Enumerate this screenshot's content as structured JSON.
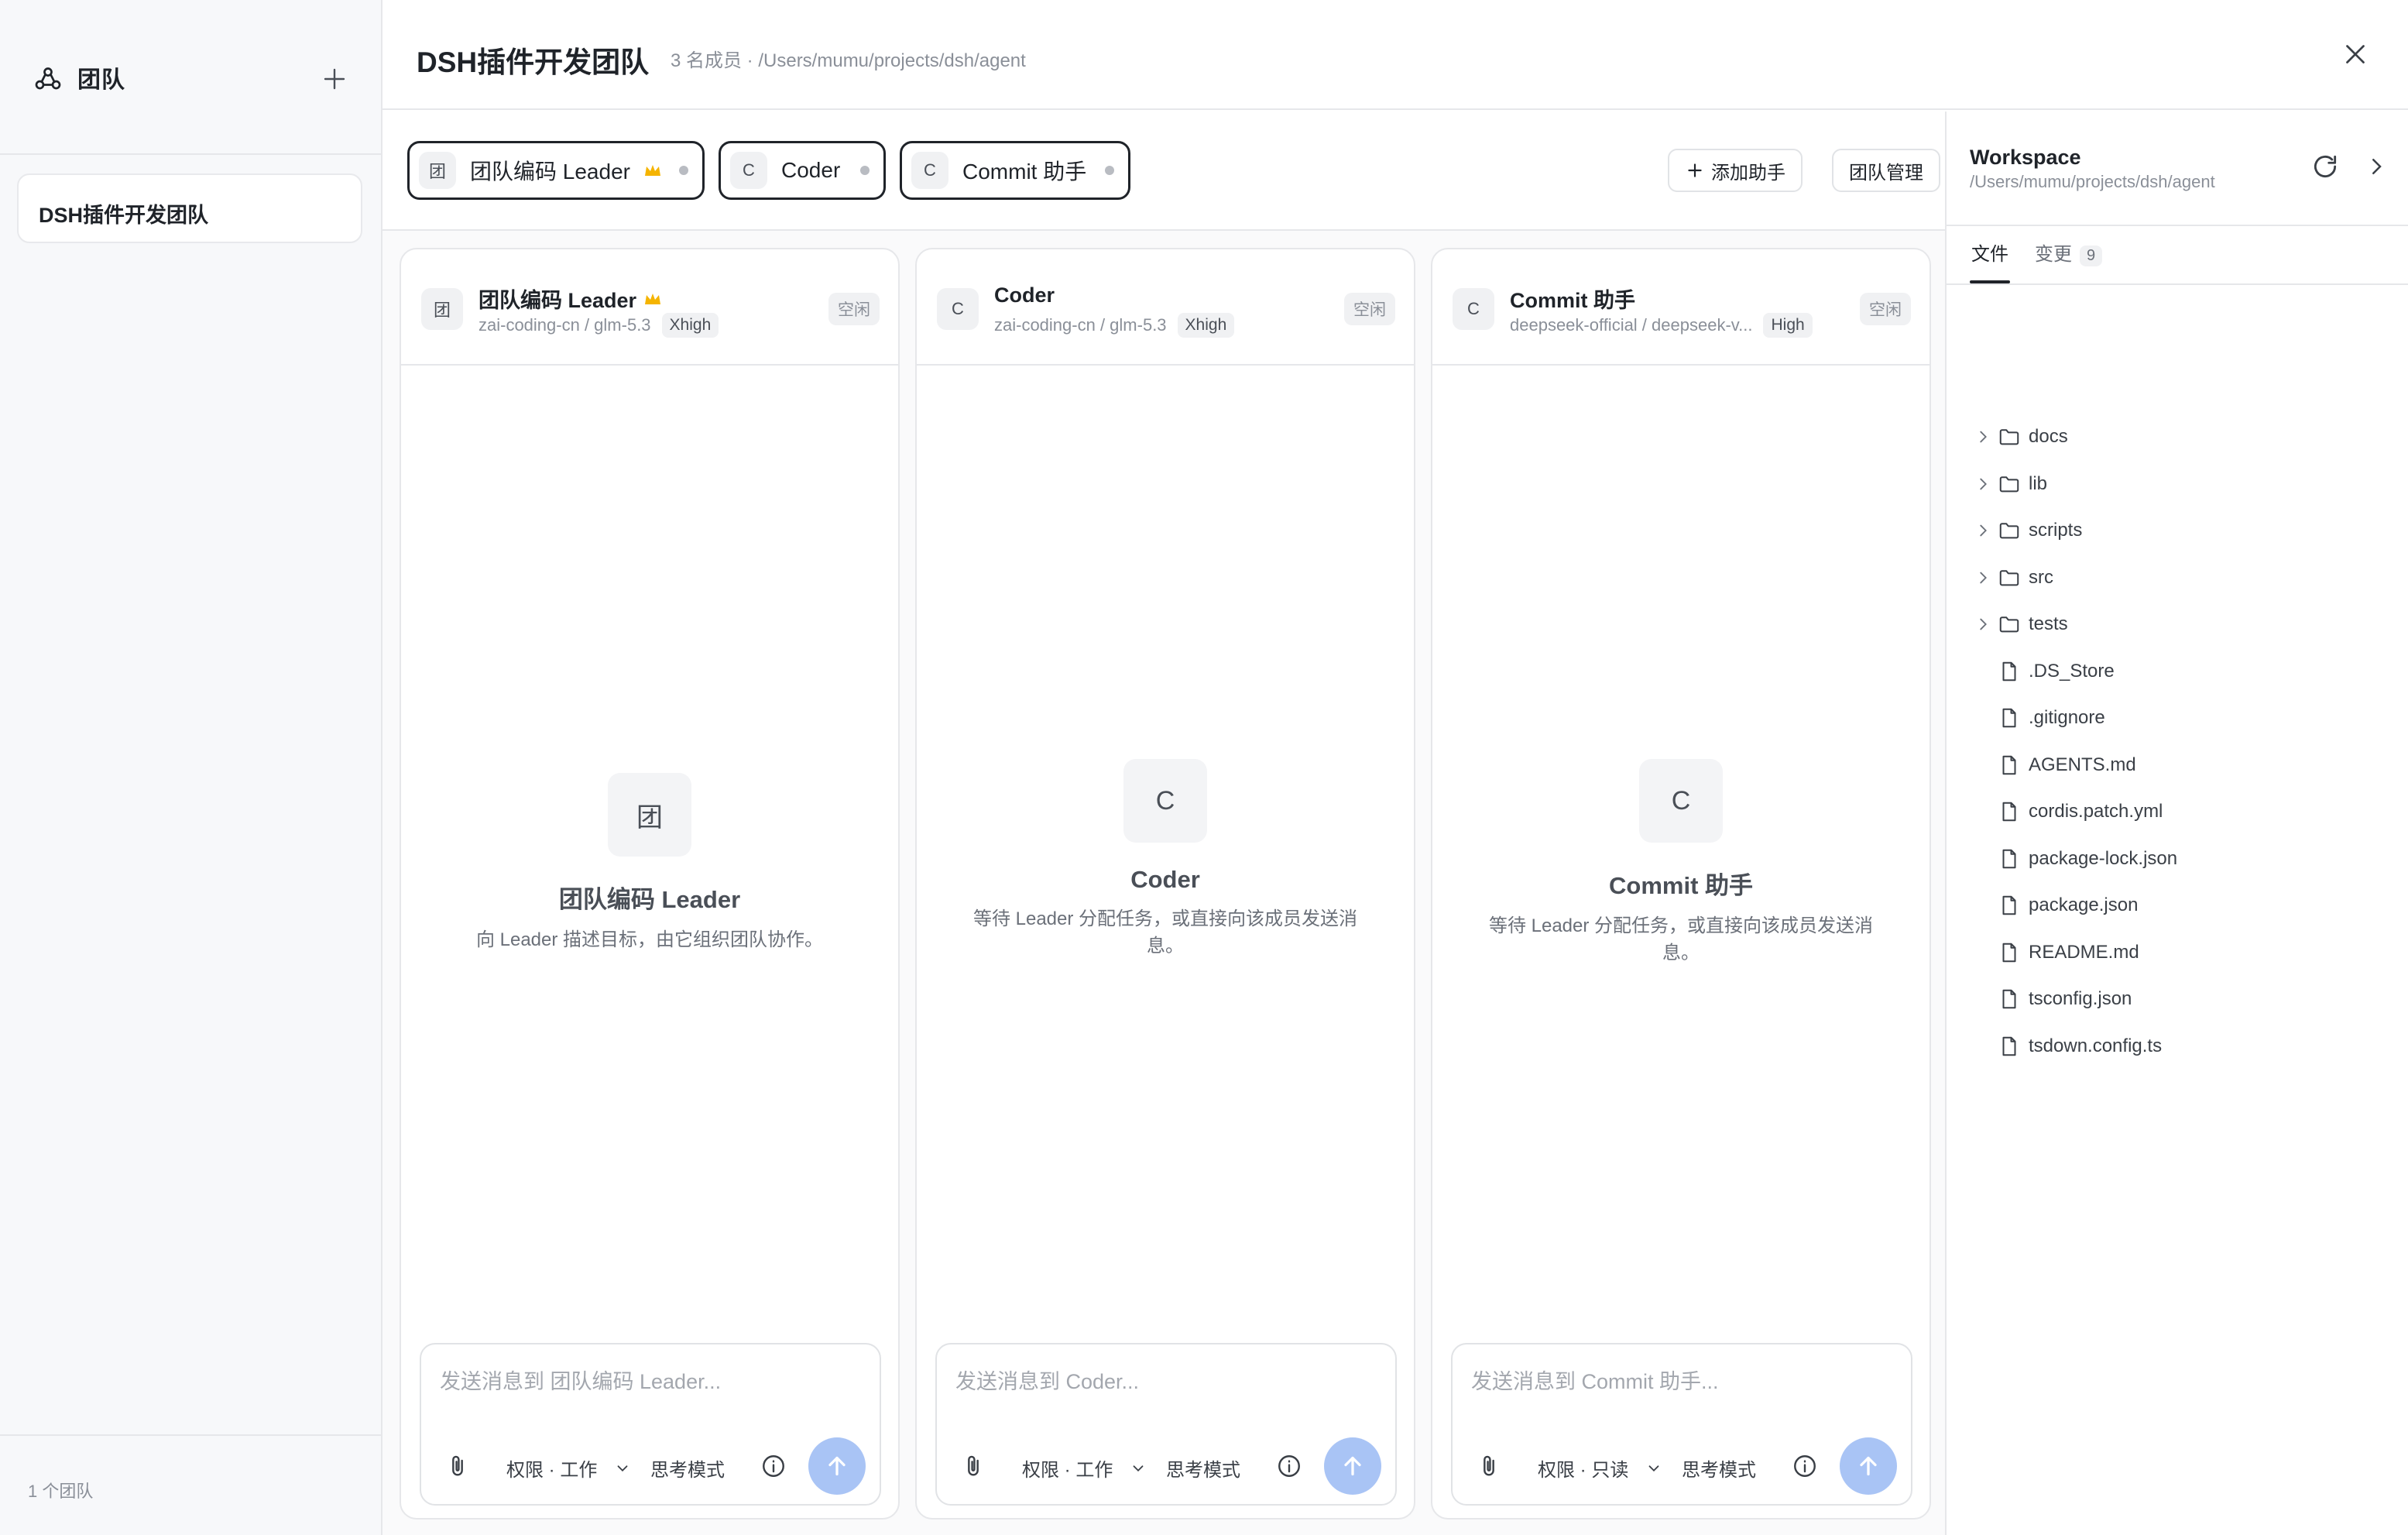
{
  "sidebar": {
    "title": "团队",
    "teams": [
      "DSH插件开发团队"
    ],
    "footer": "1 个团队"
  },
  "header": {
    "title": "DSH插件开发团队",
    "meta": "3 名成员 · /Users/mumu/projects/dsh/agent"
  },
  "member_tabs": [
    {
      "avatar": "团",
      "label": "团队编码 Leader",
      "leader": true
    },
    {
      "avatar": "C",
      "label": "Coder",
      "leader": false
    },
    {
      "avatar": "C",
      "label": "Commit 助手",
      "leader": false
    }
  ],
  "toolbar": {
    "add_label": "添加助手",
    "manage_label": "团队管理"
  },
  "columns": [
    {
      "avatar": "团",
      "name": "团队编码 Leader",
      "leader": true,
      "model": "zai-coding-cn / glm-5.3",
      "level": "Xhigh",
      "status": "空闲",
      "empty_title": "团队编码 Leader",
      "empty_desc": "向 Leader 描述目标，由它组织团队协作。",
      "placeholder": "发送消息到 团队编码 Leader...",
      "permission": "权限 · 工作",
      "think": "思考模式"
    },
    {
      "avatar": "C",
      "name": "Coder",
      "leader": false,
      "model": "zai-coding-cn / glm-5.3",
      "level": "Xhigh",
      "status": "空闲",
      "empty_title": "Coder",
      "empty_desc": "等待 Leader 分配任务，或直接向该成员发送消息。",
      "placeholder": "发送消息到 Coder...",
      "permission": "权限 · 工作",
      "think": "思考模式"
    },
    {
      "avatar": "C",
      "name": "Commit 助手",
      "leader": false,
      "model": "deepseek-official / deepseek-v...",
      "level": "High",
      "status": "空闲",
      "empty_title": "Commit 助手",
      "empty_desc": "等待 Leader 分配任务，或直接向该成员发送消息。",
      "placeholder": "发送消息到 Commit 助手...",
      "permission": "权限 · 只读",
      "think": "思考模式"
    }
  ],
  "workspace": {
    "title": "Workspace",
    "path": "/Users/mumu/projects/dsh/agent",
    "tabs": [
      {
        "label": "文件",
        "active": true
      },
      {
        "label": "变更",
        "badge": "9",
        "active": false
      }
    ],
    "tree": [
      {
        "name": "docs",
        "type": "folder"
      },
      {
        "name": "lib",
        "type": "folder"
      },
      {
        "name": "scripts",
        "type": "folder"
      },
      {
        "name": "src",
        "type": "folder"
      },
      {
        "name": "tests",
        "type": "folder"
      },
      {
        "name": ".DS_Store",
        "type": "file"
      },
      {
        "name": ".gitignore",
        "type": "file"
      },
      {
        "name": "AGENTS.md",
        "type": "file"
      },
      {
        "name": "cordis.patch.yml",
        "type": "file"
      },
      {
        "name": "package-lock.json",
        "type": "file"
      },
      {
        "name": "package.json",
        "type": "file"
      },
      {
        "name": "README.md",
        "type": "file"
      },
      {
        "name": "tsconfig.json",
        "type": "file"
      },
      {
        "name": "tsdown.config.ts",
        "type": "file"
      }
    ]
  },
  "icons": {
    "team": "team-icon",
    "add": "plus-icon",
    "close": "close-icon",
    "crown": "crown-icon",
    "attach": "paperclip-icon",
    "info": "info-icon",
    "send": "arrow-up-icon",
    "refresh": "refresh-icon",
    "chevron": "chevron-right-icon",
    "folder": "folder-icon",
    "file": "file-icon"
  },
  "colors": {
    "accent_send": "#a9c4f5",
    "crown": "#f5b400",
    "border": "#e6e7ea"
  }
}
